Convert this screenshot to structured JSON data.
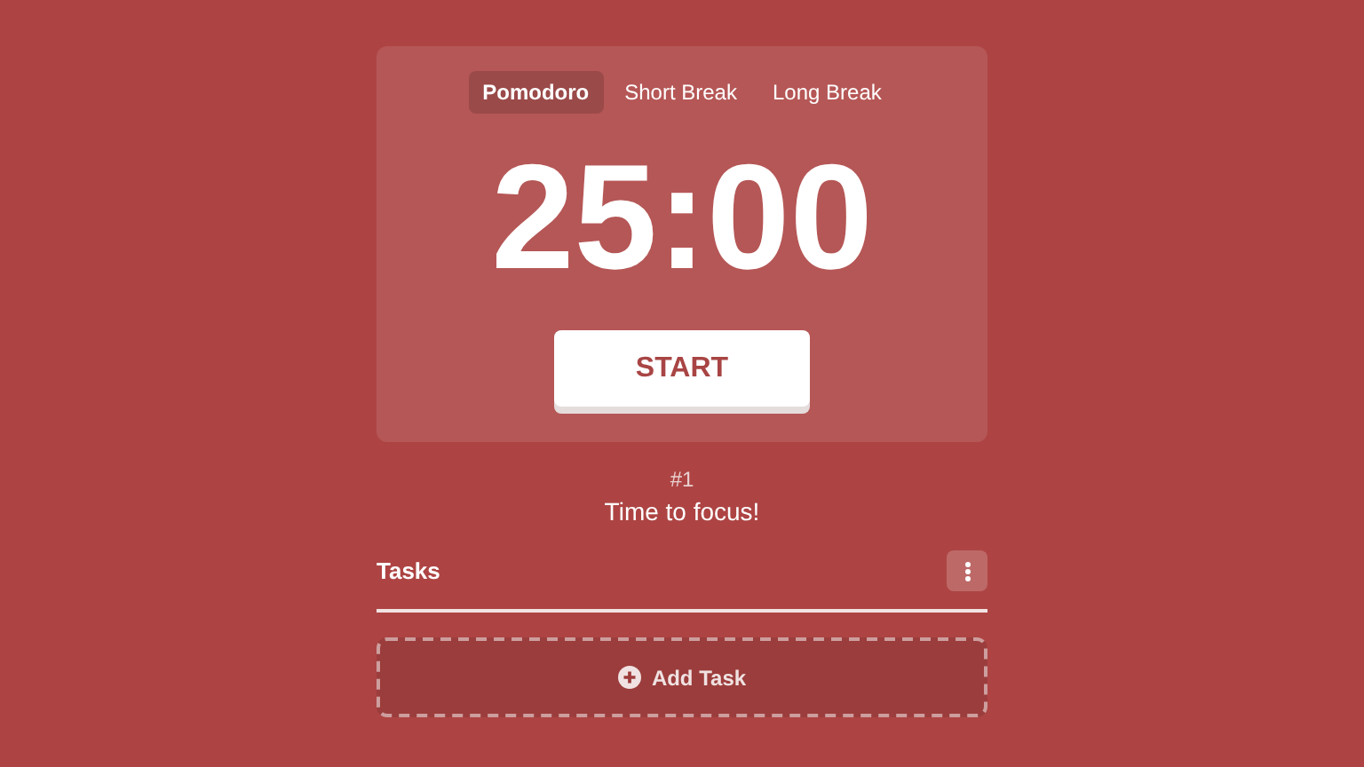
{
  "tabs": [
    {
      "label": "Pomodoro",
      "selected": true
    },
    {
      "label": "Short Break",
      "selected": false
    },
    {
      "label": "Long Break",
      "selected": false
    }
  ],
  "timer": "25:00",
  "start_button": "START",
  "session": {
    "count": "#1",
    "message": "Time to focus!"
  },
  "tasks": {
    "title": "Tasks",
    "add_button": "Add Task"
  }
}
